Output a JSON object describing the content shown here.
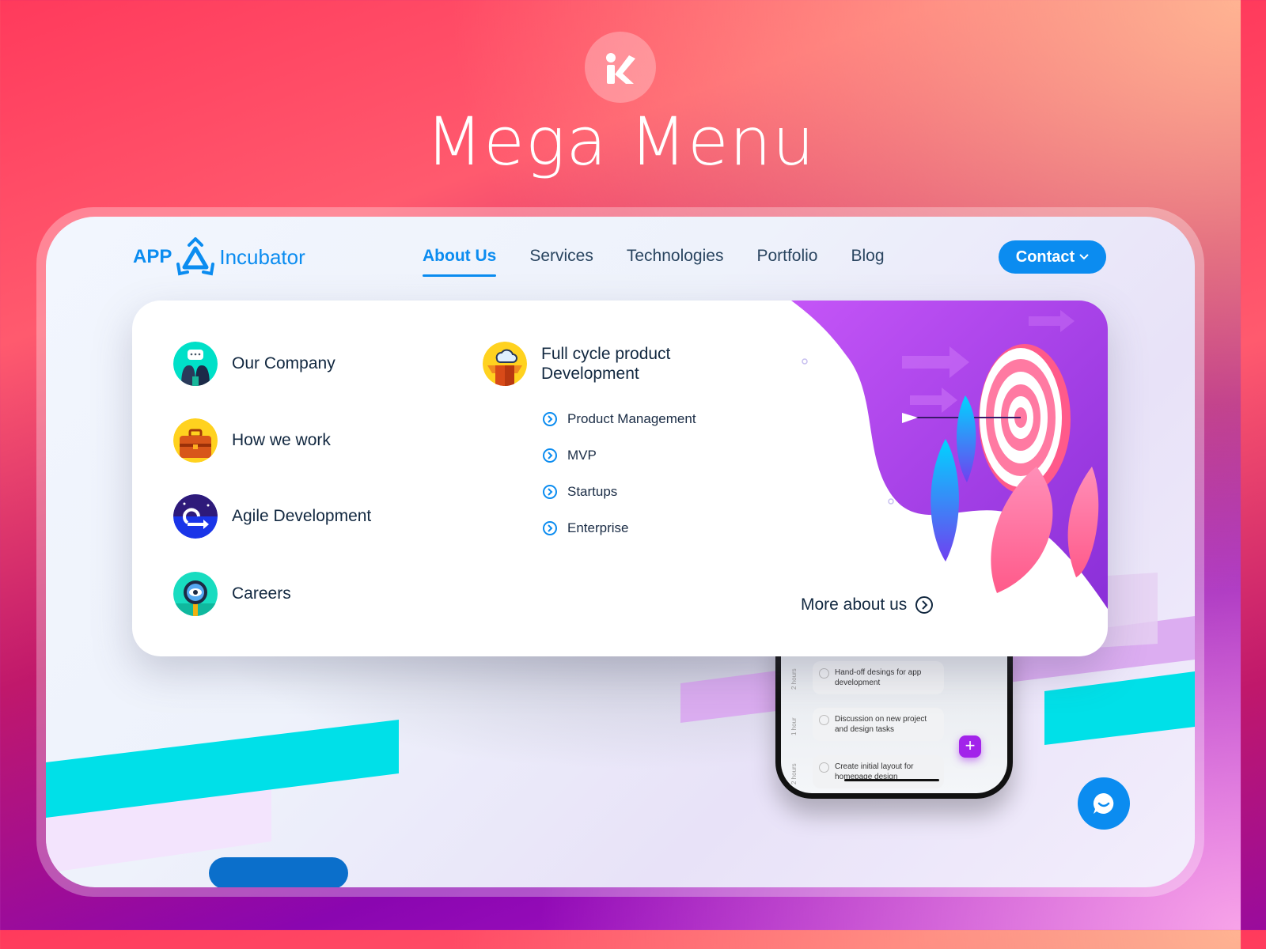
{
  "hero": {
    "logo_letter": "K",
    "title": "Mega Menu"
  },
  "site": {
    "logo_prefix": "APP",
    "logo_suffix": "Incubator",
    "nav": [
      {
        "label": "About Us",
        "active": true
      },
      {
        "label": "Services",
        "active": false
      },
      {
        "label": "Technologies",
        "active": false
      },
      {
        "label": "Portfolio",
        "active": false
      },
      {
        "label": "Blog",
        "active": false
      }
    ],
    "contact_label": "Contact"
  },
  "mega_menu": {
    "left_items": [
      {
        "label": "Our Company",
        "icon": "team-chat-icon"
      },
      {
        "label": "How we work",
        "icon": "briefcase-icon"
      },
      {
        "label": "Agile Development",
        "icon": "agile-cycle-icon"
      },
      {
        "label": "Careers",
        "icon": "magnifier-eye-icon"
      }
    ],
    "section": {
      "title_line1": "Full cycle product",
      "title_line2": "Development",
      "icon": "cloud-box-icon",
      "sub_items": [
        "Product Management",
        "MVP",
        "Startups",
        "Enterprise"
      ]
    },
    "more_label": "More about us"
  },
  "phone": {
    "tasks": [
      {
        "duration": "2 hours",
        "text": "Hand-off desings for app development"
      },
      {
        "duration": "1 hour",
        "text": "Discussion on new project and design tasks"
      },
      {
        "duration": "2 hours",
        "text": "Create initial layout for homepage design"
      }
    ],
    "add_label": "+"
  },
  "colors": {
    "accent": "#0b8cf0",
    "text_dark": "#122840",
    "purple": "#a223ea",
    "cyan": "#00e0e8"
  }
}
